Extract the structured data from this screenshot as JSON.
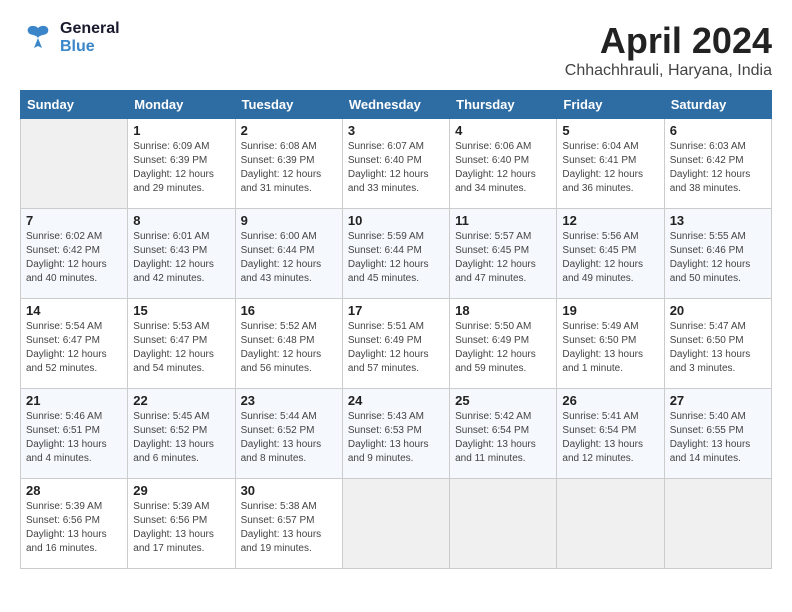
{
  "header": {
    "logo_general": "General",
    "logo_blue": "Blue",
    "month_year": "April 2024",
    "location": "Chhachhrauli, Haryana, India"
  },
  "days_of_week": [
    "Sunday",
    "Monday",
    "Tuesday",
    "Wednesday",
    "Thursday",
    "Friday",
    "Saturday"
  ],
  "weeks": [
    [
      {
        "day": "",
        "info": ""
      },
      {
        "day": "1",
        "info": "Sunrise: 6:09 AM\nSunset: 6:39 PM\nDaylight: 12 hours\nand 29 minutes."
      },
      {
        "day": "2",
        "info": "Sunrise: 6:08 AM\nSunset: 6:39 PM\nDaylight: 12 hours\nand 31 minutes."
      },
      {
        "day": "3",
        "info": "Sunrise: 6:07 AM\nSunset: 6:40 PM\nDaylight: 12 hours\nand 33 minutes."
      },
      {
        "day": "4",
        "info": "Sunrise: 6:06 AM\nSunset: 6:40 PM\nDaylight: 12 hours\nand 34 minutes."
      },
      {
        "day": "5",
        "info": "Sunrise: 6:04 AM\nSunset: 6:41 PM\nDaylight: 12 hours\nand 36 minutes."
      },
      {
        "day": "6",
        "info": "Sunrise: 6:03 AM\nSunset: 6:42 PM\nDaylight: 12 hours\nand 38 minutes."
      }
    ],
    [
      {
        "day": "7",
        "info": "Sunrise: 6:02 AM\nSunset: 6:42 PM\nDaylight: 12 hours\nand 40 minutes."
      },
      {
        "day": "8",
        "info": "Sunrise: 6:01 AM\nSunset: 6:43 PM\nDaylight: 12 hours\nand 42 minutes."
      },
      {
        "day": "9",
        "info": "Sunrise: 6:00 AM\nSunset: 6:44 PM\nDaylight: 12 hours\nand 43 minutes."
      },
      {
        "day": "10",
        "info": "Sunrise: 5:59 AM\nSunset: 6:44 PM\nDaylight: 12 hours\nand 45 minutes."
      },
      {
        "day": "11",
        "info": "Sunrise: 5:57 AM\nSunset: 6:45 PM\nDaylight: 12 hours\nand 47 minutes."
      },
      {
        "day": "12",
        "info": "Sunrise: 5:56 AM\nSunset: 6:45 PM\nDaylight: 12 hours\nand 49 minutes."
      },
      {
        "day": "13",
        "info": "Sunrise: 5:55 AM\nSunset: 6:46 PM\nDaylight: 12 hours\nand 50 minutes."
      }
    ],
    [
      {
        "day": "14",
        "info": "Sunrise: 5:54 AM\nSunset: 6:47 PM\nDaylight: 12 hours\nand 52 minutes."
      },
      {
        "day": "15",
        "info": "Sunrise: 5:53 AM\nSunset: 6:47 PM\nDaylight: 12 hours\nand 54 minutes."
      },
      {
        "day": "16",
        "info": "Sunrise: 5:52 AM\nSunset: 6:48 PM\nDaylight: 12 hours\nand 56 minutes."
      },
      {
        "day": "17",
        "info": "Sunrise: 5:51 AM\nSunset: 6:49 PM\nDaylight: 12 hours\nand 57 minutes."
      },
      {
        "day": "18",
        "info": "Sunrise: 5:50 AM\nSunset: 6:49 PM\nDaylight: 12 hours\nand 59 minutes."
      },
      {
        "day": "19",
        "info": "Sunrise: 5:49 AM\nSunset: 6:50 PM\nDaylight: 13 hours\nand 1 minute."
      },
      {
        "day": "20",
        "info": "Sunrise: 5:47 AM\nSunset: 6:50 PM\nDaylight: 13 hours\nand 3 minutes."
      }
    ],
    [
      {
        "day": "21",
        "info": "Sunrise: 5:46 AM\nSunset: 6:51 PM\nDaylight: 13 hours\nand 4 minutes."
      },
      {
        "day": "22",
        "info": "Sunrise: 5:45 AM\nSunset: 6:52 PM\nDaylight: 13 hours\nand 6 minutes."
      },
      {
        "day": "23",
        "info": "Sunrise: 5:44 AM\nSunset: 6:52 PM\nDaylight: 13 hours\nand 8 minutes."
      },
      {
        "day": "24",
        "info": "Sunrise: 5:43 AM\nSunset: 6:53 PM\nDaylight: 13 hours\nand 9 minutes."
      },
      {
        "day": "25",
        "info": "Sunrise: 5:42 AM\nSunset: 6:54 PM\nDaylight: 13 hours\nand 11 minutes."
      },
      {
        "day": "26",
        "info": "Sunrise: 5:41 AM\nSunset: 6:54 PM\nDaylight: 13 hours\nand 12 minutes."
      },
      {
        "day": "27",
        "info": "Sunrise: 5:40 AM\nSunset: 6:55 PM\nDaylight: 13 hours\nand 14 minutes."
      }
    ],
    [
      {
        "day": "28",
        "info": "Sunrise: 5:39 AM\nSunset: 6:56 PM\nDaylight: 13 hours\nand 16 minutes."
      },
      {
        "day": "29",
        "info": "Sunrise: 5:39 AM\nSunset: 6:56 PM\nDaylight: 13 hours\nand 17 minutes."
      },
      {
        "day": "30",
        "info": "Sunrise: 5:38 AM\nSunset: 6:57 PM\nDaylight: 13 hours\nand 19 minutes."
      },
      {
        "day": "",
        "info": ""
      },
      {
        "day": "",
        "info": ""
      },
      {
        "day": "",
        "info": ""
      },
      {
        "day": "",
        "info": ""
      }
    ]
  ]
}
